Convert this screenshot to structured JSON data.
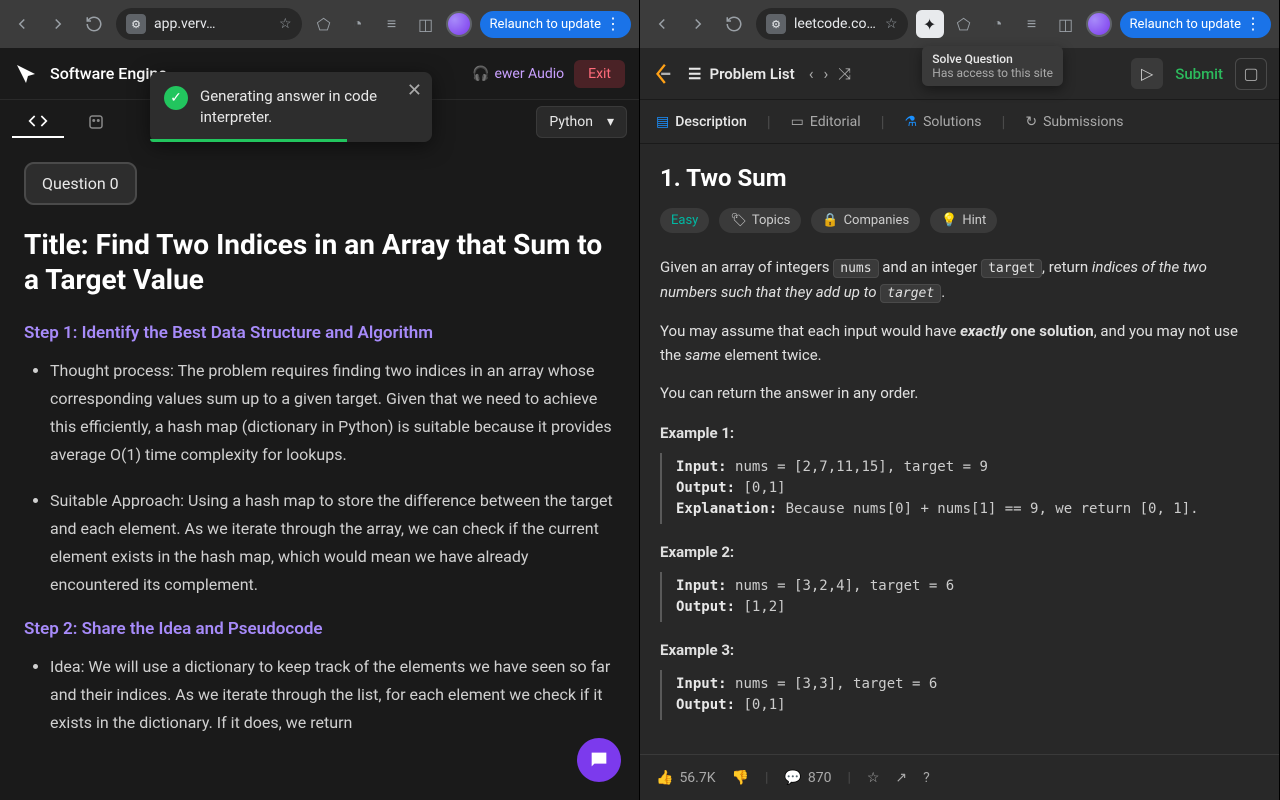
{
  "left": {
    "url": "app.verv…",
    "relaunch": "Relaunch to update",
    "app_title": "Software Engine",
    "audio_label": "ewer Audio",
    "exit": "Exit",
    "toast": "Generating answer in code interpreter.",
    "language": "Python",
    "question_chip": "Question 0",
    "title": "Title: Find Two Indices in an Array that Sum to a Target Value",
    "step1_heading": "Step 1: Identify the Best Data Structure and Algorithm",
    "step1_item1": "Thought process: The problem requires finding two indices in an array whose corresponding values sum up to a given target. Given that we need to achieve this efficiently, a hash map (dictionary in Python) is suitable because it provides average O(1) time complexity for lookups.",
    "step1_item2": "Suitable Approach: Using a hash map to store the difference between the target and each element. As we iterate through the array, we can check if the current element exists in the hash map, which would mean we have already encountered its complement.",
    "step2_heading": "Step 2: Share the Idea and Pseudocode",
    "step2_item1": "Idea: We will use a dictionary to keep track of the elements we have seen so far and their indices. As we iterate through the list, for each element we check if it exists in the dictionary. If it does, we return"
  },
  "right": {
    "url": "leetcode.com/problems…",
    "relaunch": "Relaunch to update",
    "tooltip_title": "Solve Question",
    "tooltip_sub": "Has access to this site",
    "problem_list": "Problem List",
    "submit": "Submit",
    "tabs": {
      "description": "Description",
      "editorial": "Editorial",
      "solutions": "Solutions",
      "submissions": "Submissions"
    },
    "title": "1. Two Sum",
    "chips": {
      "easy": "Easy",
      "topics": "Topics",
      "companies": "Companies",
      "hint": "Hint"
    },
    "body": {
      "p1a": "Given an array of integers ",
      "nums": "nums",
      "p1b": " and an integer ",
      "target": "target",
      "p1c": ", return ",
      "p1d": "indices of the two numbers such that they add up to ",
      "p1e": ".",
      "p2a": "You may assume that each input would have ",
      "p2b": "exactly",
      "p2c": " one solution",
      "p2d": ", and you may not use the ",
      "p2e": "same",
      "p2f": " element twice.",
      "p3": "You can return the answer in any order."
    },
    "ex1_label": "Example 1:",
    "ex1_in": "nums = [2,7,11,15], target = 9",
    "ex1_out": "[0,1]",
    "ex1_exp": "Because nums[0] + nums[1] == 9, we return [0, 1].",
    "ex2_label": "Example 2:",
    "ex2_in": "nums = [3,2,4], target = 6",
    "ex2_out": "[1,2]",
    "ex3_label": "Example 3:",
    "ex3_in": "nums = [3,3], target = 6",
    "ex3_out": "[0,1]",
    "likes": "56.7K",
    "comments": "870",
    "labels": {
      "input": "Input: ",
      "output": "Output: ",
      "explanation": "Explanation: "
    }
  }
}
